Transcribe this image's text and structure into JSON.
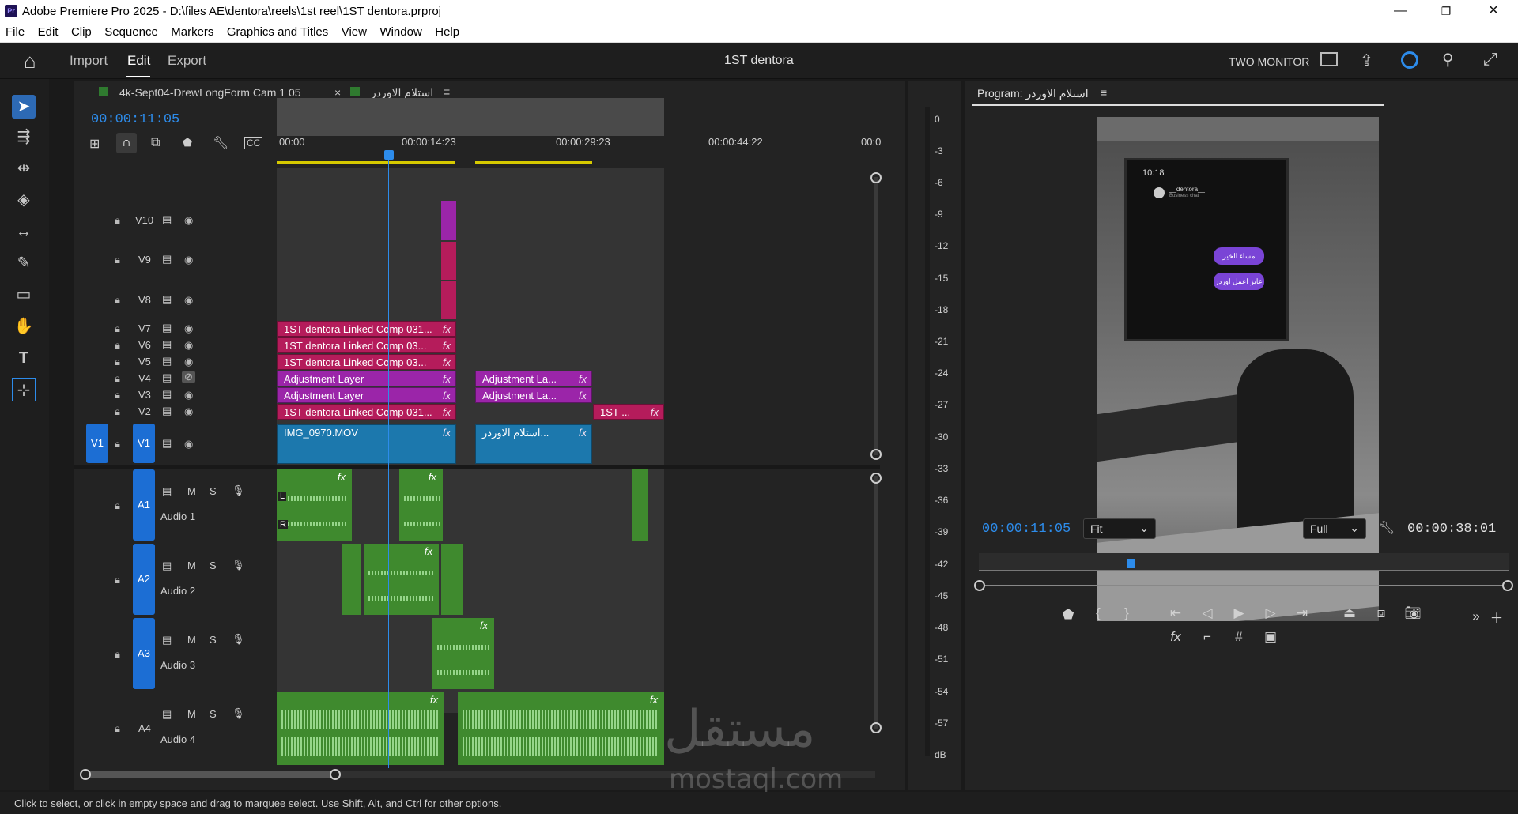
{
  "window": {
    "title": "Adobe Premiere Pro 2025 - D:\\files AE\\dentora\\reels\\1st reel\\1ST dentora.prproj",
    "logo_text": "Pr",
    "minimize": "—",
    "restore": "❐",
    "close": "✕"
  },
  "menu": [
    "File",
    "Edit",
    "Clip",
    "Sequence",
    "Markers",
    "Graphics and Titles",
    "View",
    "Window",
    "Help"
  ],
  "header": {
    "home": "⌂",
    "nav": [
      "Import",
      "Edit",
      "Export"
    ],
    "active_nav": "Edit",
    "project_title": "1ST dentora",
    "workspace": "TWO MONITOR"
  },
  "timeline": {
    "tab1": "4k-Sept04-DrewLongForm Cam 1 05",
    "tab2_close": "×",
    "tab2": "استلام الاوردر",
    "tab_menu": "≡",
    "timecode": "00:00:11:05",
    "ruler": [
      "00:00",
      "00:00:14:23",
      "00:00:29:23",
      "00:00:44:22",
      "00:0"
    ],
    "video_tracks": [
      "V10",
      "V9",
      "V8",
      "V7",
      "V6",
      "V5",
      "V4",
      "V3",
      "V2",
      "V1"
    ],
    "source_patch_v": "V1",
    "audio_tracks": [
      {
        "id": "A1",
        "name": "Audio 1"
      },
      {
        "id": "A2",
        "name": "Audio 2"
      },
      {
        "id": "A3",
        "name": "Audio 3"
      },
      {
        "id": "A4",
        "name": "Audio 4"
      }
    ],
    "mute": "M",
    "solo": "S",
    "clips": {
      "v7": "1ST dentora Linked Comp 031...",
      "v6": "1ST dentora Linked Comp 03...",
      "v5": "1ST dentora Linked Comp 03...",
      "v4a": "Adjustment Layer",
      "v4b": "Adjustment La...",
      "v3a": "Adjustment Layer",
      "v3b": "Adjustment La...",
      "v2a": "1ST dentora Linked Comp 031...",
      "v2b": "1ST ...",
      "v1a": "IMG_0970.MOV",
      "v1b": "استلام الاوردر...",
      "fx": "fx"
    },
    "channel_l": "L",
    "channel_r": "R"
  },
  "meter": {
    "scale": [
      "0",
      "-3",
      "-6",
      "-9",
      "-12",
      "-15",
      "-18",
      "-21",
      "-24",
      "-27",
      "-30",
      "-33",
      "-36",
      "-39",
      "-42",
      "-45",
      "-48",
      "-51",
      "-54",
      "-57",
      "dB"
    ]
  },
  "program": {
    "title": "Program: استلام الاوردر",
    "menu": "≡",
    "timecode": "00:00:11:05",
    "fit": "Fit",
    "quality": "Full",
    "duration": "00:00:38:01",
    "phone_time": "10:18",
    "phone_user": "__dentora__",
    "phone_sub": "Business chat",
    "bubble1": "مساء الخير",
    "bubble2": "عايز اعمل اوردر"
  },
  "watermark": {
    "arabic": "مستقل",
    "latin": "mostaql.com"
  },
  "status": "Click to select, or click in empty space and drag to marquee select. Use Shift, Alt, and Ctrl for other options.",
  "colors": {
    "accent": "#2d8ceb",
    "pink_clip": "#b51c5b",
    "purple_clip": "#9b25a9",
    "blue_clip": "#1c78ad",
    "audio_clip": "#3f8a2e"
  }
}
